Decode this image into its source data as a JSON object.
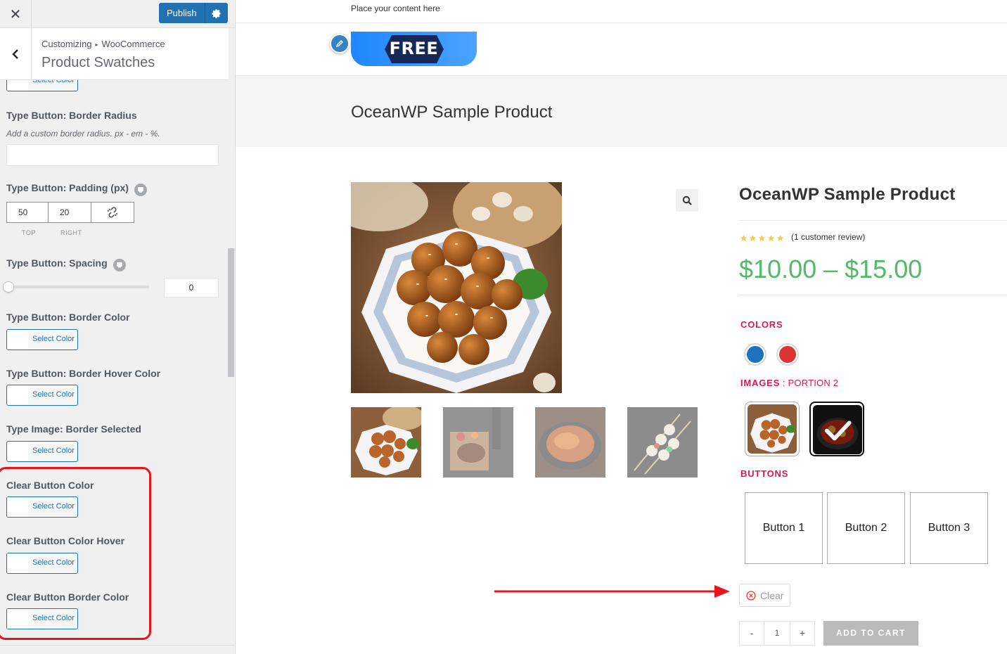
{
  "customizer": {
    "close_icon": "close-icon",
    "publish_label": "Publish",
    "breadcrumb": {
      "root": "Customizing",
      "parent": "WooCommerce"
    },
    "section_title": "Product Swatches",
    "controls": {
      "partial_select": "Select Color",
      "border_radius": {
        "label": "Type Button: Border Radius",
        "desc": "Add a custom border radius. px - em - %.",
        "value": ""
      },
      "padding": {
        "label": "Type Button: Padding (px)",
        "top": "50",
        "right": "20",
        "top_label": "TOP",
        "right_label": "RIGHT"
      },
      "spacing": {
        "label": "Type Button: Spacing",
        "value": "0",
        "slider_fraction": 0
      },
      "border_color": {
        "label": "Type Button: Border Color",
        "button": "Select Color"
      },
      "border_hover_color": {
        "label": "Type Button: Border Hover Color",
        "button": "Select Color"
      },
      "image_border_selected": {
        "label": "Type Image: Border Selected",
        "button": "Select Color"
      },
      "clear_button_color": {
        "label": "Clear Button Color",
        "button": "Select Color"
      },
      "clear_button_color_hover": {
        "label": "Clear Button Color Hover",
        "button": "Select Color"
      },
      "clear_button_border_color": {
        "label": "Clear Button Border Color",
        "button": "Select Color"
      }
    }
  },
  "preview": {
    "topbar_text": "Place your content here",
    "logo_text": "FREE",
    "page_title": "OceanWP Sample Product",
    "product": {
      "title": "OceanWP Sample Product",
      "rating": 5,
      "review_text": "(1 customer review)",
      "price": "$10.00 – $15.00",
      "attributes": {
        "colors": {
          "title": "COLORS",
          "options": [
            "#1e73be",
            "#dd3333"
          ]
        },
        "images": {
          "title": "IMAGES",
          "selected": " : PORTION 2"
        },
        "buttons": {
          "title": "BUTTONS",
          "options": [
            "Button 1",
            "Button 2",
            "Button 3"
          ]
        }
      },
      "clear_label": "Clear",
      "quantity": "1",
      "qty_minus": "-",
      "qty_plus": "+",
      "add_to_cart": "ADD TO CART"
    }
  },
  "colors": {
    "wp_blue": "#2271b1",
    "price_green": "#52b968",
    "attr_pink": "#e0155b",
    "highlight_red": "#e8141c"
  }
}
